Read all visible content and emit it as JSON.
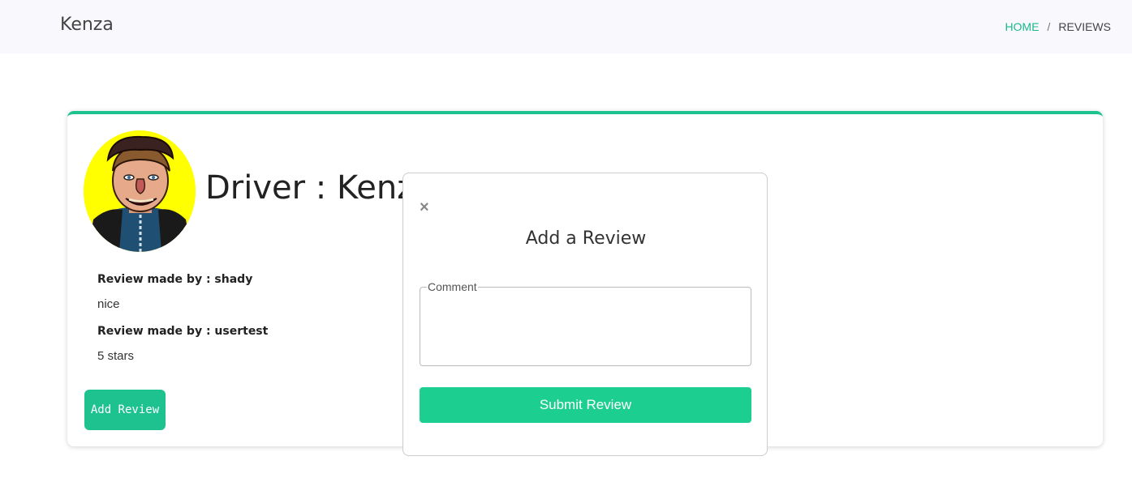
{
  "header": {
    "brand": "Kenza",
    "breadcrumb": {
      "home": "HOME",
      "separator": "/",
      "current": "REVIEWS"
    }
  },
  "profile": {
    "title": "Driver : Kenza",
    "avatar_icon": "driver-avatar-illustration"
  },
  "reviews": [
    {
      "author_label": "Review made by : shady",
      "text": "nice"
    },
    {
      "author_label": "Review made by : usertest",
      "text": "5 stars"
    }
  ],
  "add_review_label": "Add Review",
  "modal": {
    "close_icon": "close-icon",
    "close_glyph": "×",
    "title": "Add a Review",
    "comment_label": "Comment",
    "comment_value": "",
    "submit_label": "Submit Review"
  },
  "colors": {
    "accent": "#1ec28f",
    "breadcrumb_active": "#1ab98a",
    "avatar_bg": "#ffff00"
  }
}
